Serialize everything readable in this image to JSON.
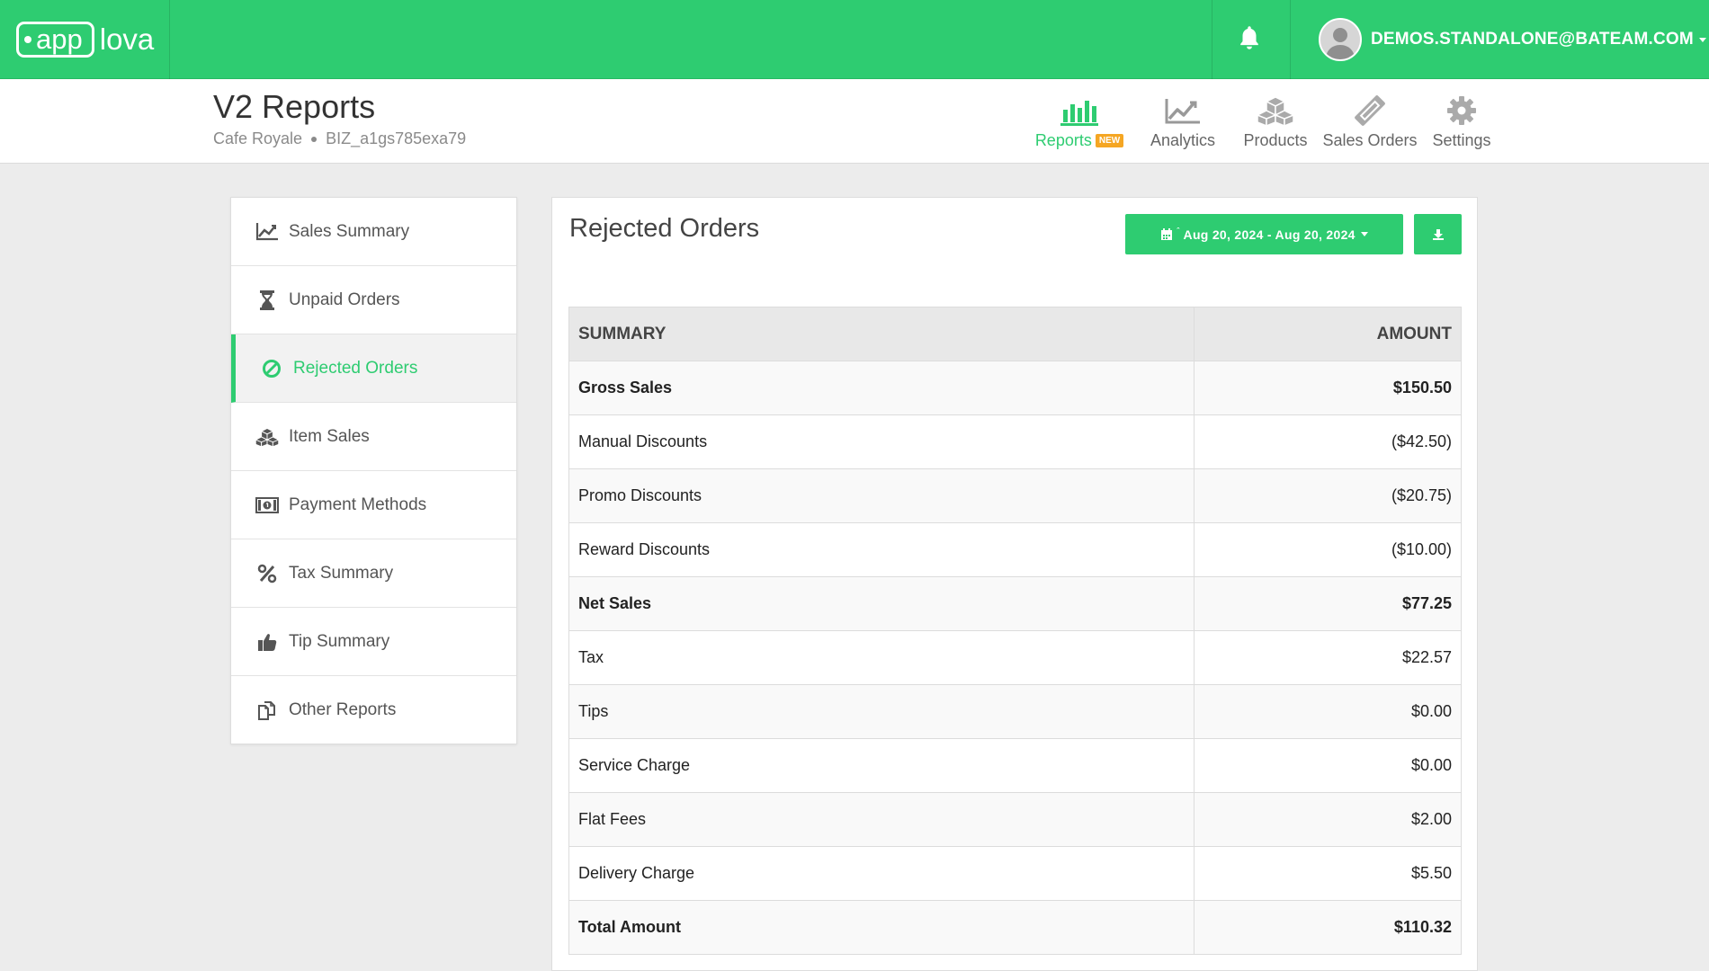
{
  "brand": {
    "logo_part1": "app",
    "logo_part2": "lova"
  },
  "user": {
    "email": "DEMOS.STANDALONE@BATEAM.COM"
  },
  "page": {
    "title": "V2 Reports",
    "business_name": "Cafe Royale",
    "business_id": "BIZ_a1gs785exa79"
  },
  "top_nav": [
    {
      "label": "Reports",
      "badge": "NEW",
      "icon": "bar-chart-icon",
      "active": true
    },
    {
      "label": "Analytics",
      "icon": "line-chart-icon",
      "active": false
    },
    {
      "label": "Products",
      "icon": "cubes-icon",
      "active": false
    },
    {
      "label": "Sales Orders",
      "icon": "ticket-icon",
      "active": false
    },
    {
      "label": "Settings",
      "icon": "gear-icon",
      "active": false
    }
  ],
  "sidebar": {
    "items": [
      {
        "label": "Sales Summary",
        "icon": "line-chart-icon"
      },
      {
        "label": "Unpaid Orders",
        "icon": "hourglass-icon"
      },
      {
        "label": "Rejected Orders",
        "icon": "ban-icon",
        "active": true
      },
      {
        "label": "Item Sales",
        "icon": "cubes-icon"
      },
      {
        "label": "Payment Methods",
        "icon": "money-icon"
      },
      {
        "label": "Tax Summary",
        "icon": "percent-icon"
      },
      {
        "label": "Tip Summary",
        "icon": "thumbs-up-icon"
      },
      {
        "label": "Other Reports",
        "icon": "copy-icon"
      }
    ]
  },
  "report": {
    "title": "Rejected Orders",
    "date_range": "Aug 20, 2024 - Aug 20, 2024",
    "columns": {
      "summary": "SUMMARY",
      "amount": "AMOUNT"
    },
    "rows": [
      {
        "label": "Gross Sales",
        "amount": "$150.50",
        "bold": true
      },
      {
        "label": "Manual Discounts",
        "amount": "($42.50)"
      },
      {
        "label": "Promo Discounts",
        "amount": "($20.75)"
      },
      {
        "label": "Reward Discounts",
        "amount": "($10.00)"
      },
      {
        "label": "Net Sales",
        "amount": "$77.25",
        "bold": true
      },
      {
        "label": "Tax",
        "amount": "$22.57"
      },
      {
        "label": "Tips",
        "amount": "$0.00"
      },
      {
        "label": "Service Charge",
        "amount": "$0.00"
      },
      {
        "label": "Flat Fees",
        "amount": "$2.00"
      },
      {
        "label": "Delivery Charge",
        "amount": "$5.50"
      },
      {
        "label": "Total Amount",
        "amount": "$110.32",
        "bold": true
      }
    ]
  },
  "colors": {
    "brand_green": "#2ecc71",
    "badge_orange": "#f5a623"
  }
}
